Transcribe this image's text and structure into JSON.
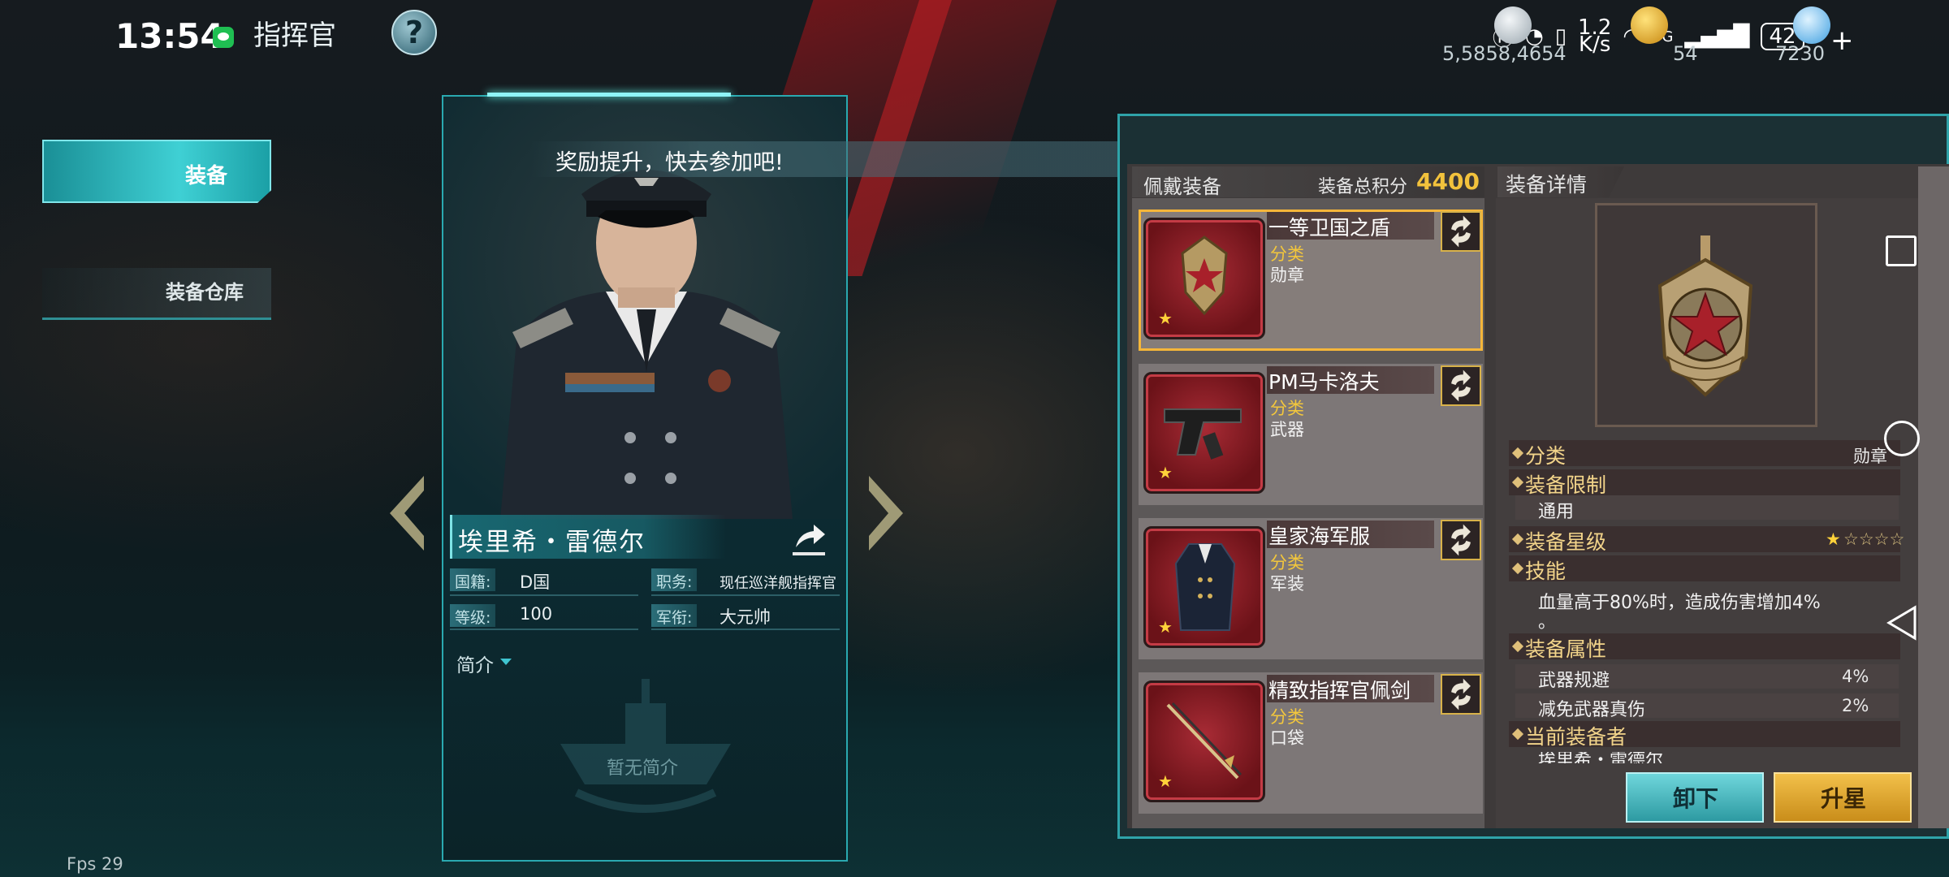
{
  "status_bar": {
    "time": "13:54",
    "page_title": "指挥官",
    "help_label": "?",
    "net_speed_top": "1.2",
    "net_speed_bottom": "K/s",
    "network": "5G",
    "battery": "42"
  },
  "currencies": [
    {
      "name": "silver",
      "value": "5,5858,4654",
      "color": "#c9d2d8"
    },
    {
      "name": "gold",
      "value": "54",
      "color": "#f0b638"
    },
    {
      "name": "diamond",
      "value": "7230",
      "color": "#7fc8ff"
    }
  ],
  "nav": {
    "equip_label": "装备",
    "storage_label": "装备仓库"
  },
  "notice": "奖励提升，快去参加吧!",
  "commander": {
    "name": "埃里希・雷德尔",
    "nationality_key": "国籍:",
    "nationality": "D国",
    "post_key": "职务:",
    "post": "现任巡洋舰指挥官",
    "level_key": "等级:",
    "level": "100",
    "rank_key": "军衔:",
    "rank": "大元帅",
    "intro_label": "简介",
    "no_intro": "暂无简介"
  },
  "equipment": {
    "worn_title": "佩戴装备",
    "score_label": "装备总积分",
    "score": "4400",
    "items": [
      {
        "name": "一等卫国之盾",
        "cat_key": "分类",
        "category": "勋章",
        "stars": "★"
      },
      {
        "name": "PM马卡洛夫",
        "cat_key": "分类",
        "category": "武器",
        "stars": "★"
      },
      {
        "name": "皇家海军服",
        "cat_key": "分类",
        "category": "军装",
        "stars": "★"
      },
      {
        "name": "精致指挥官佩剑",
        "cat_key": "分类",
        "category": "口袋",
        "stars": "★"
      }
    ]
  },
  "detail": {
    "title": "装备详情",
    "category_key": "分类",
    "category": "勋章",
    "limit_key": "装备限制",
    "limit": "通用",
    "star_key": "装备星级",
    "star_filled": "★",
    "star_empty": "☆☆☆☆",
    "skill_key": "技能",
    "skill_text": "血量高于80%时，造成伤害增加4%",
    "skill_text_cont": "。",
    "attr_key": "装备属性",
    "attrs": [
      {
        "name": "武器规避",
        "value": "4%"
      },
      {
        "name": "减免武器真伤",
        "value": "2%"
      }
    ],
    "wearer_key": "当前装备者",
    "wearer": "埃里希・雷德尔",
    "btn_unload": "卸下",
    "btn_upgrade": "升星"
  },
  "fps": "Fps 29"
}
